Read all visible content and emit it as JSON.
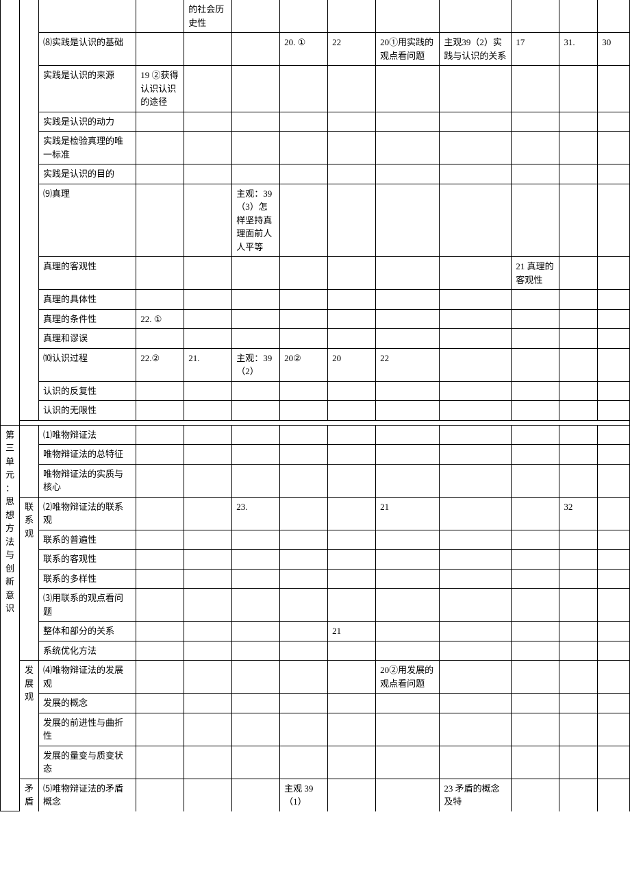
{
  "top_partial_cell_c4": "的社会历史性",
  "rows": [
    {
      "c2": "⑻实践是认识的基础",
      "c3": "",
      "c4": "",
      "c5": "",
      "c6": "20. ①",
      "c7": "22",
      "c8": "20①用实践的观点看问题",
      "c9": "主观39（2）实践与认识的关系",
      "c10": "17",
      "c11": "31.",
      "c12": "30"
    },
    {
      "c2": "实践是认识的来源",
      "c3": "19 ②获得认识认识的途径",
      "c4": "",
      "c5": "",
      "c6": "",
      "c7": "",
      "c8": "",
      "c9": "",
      "c10": "",
      "c11": "",
      "c12": ""
    },
    {
      "c2": "实践是认识的动力",
      "c3": "",
      "c4": "",
      "c5": "",
      "c6": "",
      "c7": "",
      "c8": "",
      "c9": "",
      "c10": "",
      "c11": "",
      "c12": ""
    },
    {
      "c2": "实践是检验真理的唯一标准",
      "c3": "",
      "c4": "",
      "c5": "",
      "c6": "",
      "c7": "",
      "c8": "",
      "c9": "",
      "c10": "",
      "c11": "",
      "c12": ""
    },
    {
      "c2": "实践是认识的目的",
      "c3": "",
      "c4": "",
      "c5": "",
      "c6": "",
      "c7": "",
      "c8": "",
      "c9": "",
      "c10": "",
      "c11": "",
      "c12": ""
    },
    {
      "c2": "⑼真理",
      "c3": "",
      "c4": "",
      "c5": "主观：39（3）怎样坚持真理面前人人平等",
      "c6": "",
      "c7": "",
      "c8": "",
      "c9": "",
      "c10": "",
      "c11": "",
      "c12": ""
    },
    {
      "c2": "真理的客观性",
      "c3": "",
      "c4": "",
      "c5": "",
      "c6": "",
      "c7": "",
      "c8": "",
      "c9": "",
      "c10": "21 真理的客观性",
      "c11": "",
      "c12": ""
    },
    {
      "c2": "真理的具体性",
      "c3": "",
      "c4": "",
      "c5": "",
      "c6": "",
      "c7": "",
      "c8": "",
      "c9": "",
      "c10": "",
      "c11": "",
      "c12": ""
    },
    {
      "c2": "真理的条件性",
      "c3": "22. ①",
      "c4": "",
      "c5": "",
      "c6": "",
      "c7": "",
      "c8": "",
      "c9": "",
      "c10": "",
      "c11": "",
      "c12": ""
    },
    {
      "c2": "真理和谬误",
      "c3": "",
      "c4": "",
      "c5": "",
      "c6": "",
      "c7": "",
      "c8": "",
      "c9": "",
      "c10": "",
      "c11": "",
      "c12": ""
    },
    {
      "c2": "⑽认识过程",
      "c3": "22.②",
      "c4": "21.",
      "c5": "主观：39（2）",
      "c6": "20②",
      "c7": "20",
      "c8": "22",
      "c9": "",
      "c10": "",
      "c11": "",
      "c12": ""
    },
    {
      "c2": "认识的反复性",
      "c3": "",
      "c4": "",
      "c5": "",
      "c6": "",
      "c7": "",
      "c8": "",
      "c9": "",
      "c10": "",
      "c11": "",
      "c12": ""
    },
    {
      "c2": "认识的无限性",
      "c3": "",
      "c4": "",
      "c5": "",
      "c6": "",
      "c7": "",
      "c8": "",
      "c9": "",
      "c10": "",
      "c11": "",
      "c12": ""
    }
  ],
  "gap_row": true,
  "unit3_label_chars": [
    "第",
    "三",
    "单",
    "元",
    "：",
    "思",
    "想",
    "方",
    "法",
    "与",
    "创",
    "新",
    "意",
    "识"
  ],
  "section_lianxi_label_chars": [
    "联",
    "系",
    "观"
  ],
  "section_fazhan_label_chars": [
    "发",
    "展",
    "观"
  ],
  "section_maodun_label_chars": [
    "矛",
    "盾"
  ],
  "unit3_rows": [
    {
      "c2": "⑴唯物辩证法",
      "c3": "",
      "c4": "",
      "c5": "",
      "c6": "",
      "c7": "",
      "c8": "",
      "c9": "",
      "c10": "",
      "c11": "",
      "c12": ""
    },
    {
      "c2": "唯物辩证法的总特征",
      "c3": "",
      "c4": "",
      "c5": "",
      "c6": "",
      "c7": "",
      "c8": "",
      "c9": "",
      "c10": "",
      "c11": "",
      "c12": ""
    },
    {
      "c2": "唯物辩证法的实质与核心",
      "c3": "",
      "c4": "",
      "c5": "",
      "c6": "",
      "c7": "",
      "c8": "",
      "c9": "",
      "c10": "",
      "c11": "",
      "c12": ""
    }
  ],
  "lianxi_rows": [
    {
      "c2": "⑵唯物辩证法的联系观",
      "c3": "",
      "c4": "",
      "c5": "23.",
      "c6": "",
      "c7": "",
      "c8": "21",
      "c9": "",
      "c10": "",
      "c11": "32",
      "c12": ""
    },
    {
      "c2": "联系的普遍性",
      "c3": "",
      "c4": "",
      "c5": "",
      "c6": "",
      "c7": "",
      "c8": "",
      "c9": "",
      "c10": "",
      "c11": "",
      "c12": ""
    },
    {
      "c2": "联系的客观性",
      "c3": "",
      "c4": "",
      "c5": "",
      "c6": "",
      "c7": "",
      "c8": "",
      "c9": "",
      "c10": "",
      "c11": "",
      "c12": ""
    },
    {
      "c2": "联系的多样性",
      "c3": "",
      "c4": "",
      "c5": "",
      "c6": "",
      "c7": "",
      "c8": "",
      "c9": "",
      "c10": "",
      "c11": "",
      "c12": ""
    },
    {
      "c2": "⑶用联系的观点看问题",
      "c3": "",
      "c4": "",
      "c5": "",
      "c6": "",
      "c7": "",
      "c8": "",
      "c9": "",
      "c10": "",
      "c11": "",
      "c12": ""
    },
    {
      "c2": "整体和部分的关系",
      "c3": "",
      "c4": "",
      "c5": "",
      "c6": "",
      "c7": "21",
      "c8": "",
      "c9": "",
      "c10": "",
      "c11": "",
      "c12": ""
    },
    {
      "c2": "系统优化方法",
      "c3": "",
      "c4": "",
      "c5": "",
      "c6": "",
      "c7": "",
      "c8": "",
      "c9": "",
      "c10": "",
      "c11": "",
      "c12": ""
    }
  ],
  "fazhan_rows": [
    {
      "c2": "⑷唯物辩证法的发展观",
      "c3": "",
      "c4": "",
      "c5": "",
      "c6": "",
      "c7": "",
      "c8": "20②用发展的观点看问题",
      "c9": "",
      "c10": "",
      "c11": "",
      "c12": ""
    },
    {
      "c2": "发展的概念",
      "c3": "",
      "c4": "",
      "c5": "",
      "c6": "",
      "c7": "",
      "c8": "",
      "c9": "",
      "c10": "",
      "c11": "",
      "c12": ""
    },
    {
      "c2": "发展的前进性与曲折性",
      "c3": "",
      "c4": "",
      "c5": "",
      "c6": "",
      "c7": "",
      "c8": "",
      "c9": "",
      "c10": "",
      "c11": "",
      "c12": ""
    },
    {
      "c2": "发展的量变与质变状态",
      "c3": "",
      "c4": "",
      "c5": "",
      "c6": "",
      "c7": "",
      "c8": "",
      "c9": "",
      "c10": "",
      "c11": "",
      "c12": ""
    }
  ],
  "maodun_rows": [
    {
      "c2": "⑸唯物辩证法的矛盾概念",
      "c3": "",
      "c4": "",
      "c5": "",
      "c6": "主观 39（1）",
      "c7": "",
      "c8": "",
      "c9": "23 矛盾的概念及特",
      "c10": "",
      "c11": "",
      "c12": ""
    }
  ]
}
